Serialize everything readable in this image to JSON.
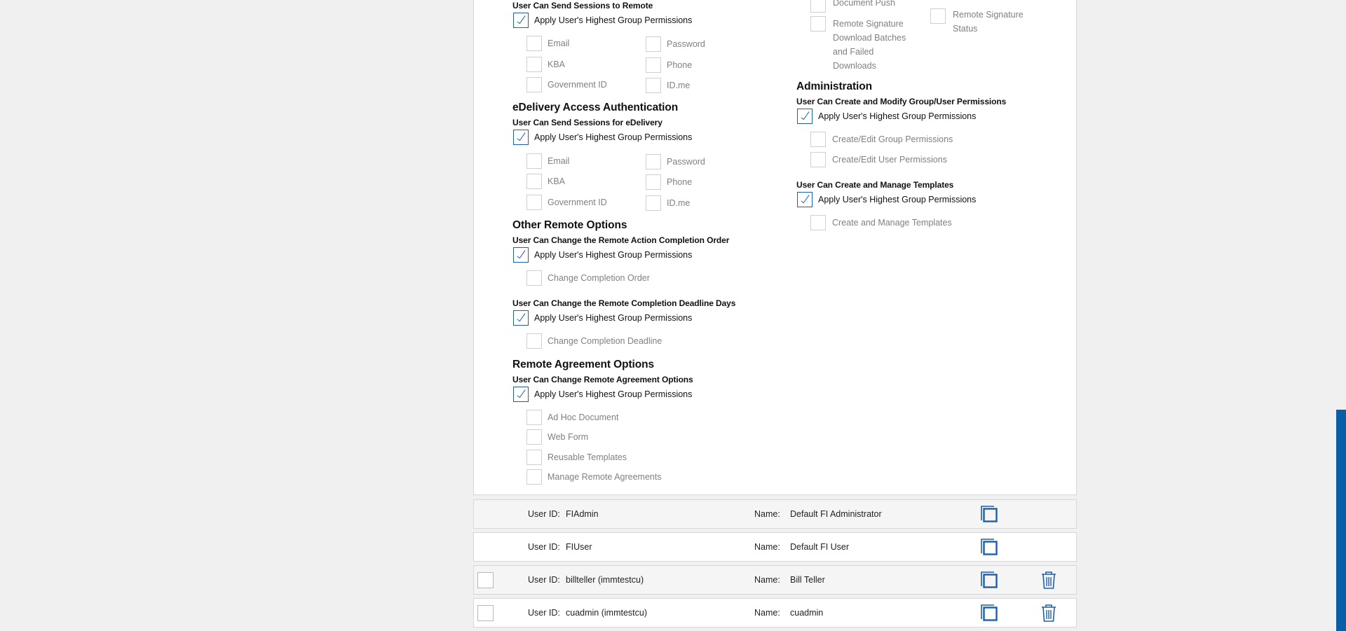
{
  "remote_send": {
    "sub": "User Can Send Sessions to Remote",
    "apply": "Apply User's Highest Group Permissions",
    "options": [
      "Email",
      "Password",
      "KBA",
      "Phone",
      "Government ID",
      "ID.me"
    ]
  },
  "edelivery": {
    "title": "eDelivery Access Authentication",
    "sub": "User Can Send Sessions for eDelivery",
    "apply": "Apply User's Highest Group Permissions",
    "options": [
      "Email",
      "Password",
      "KBA",
      "Phone",
      "Government ID",
      "ID.me"
    ]
  },
  "other_remote": {
    "title": "Other Remote Options",
    "sub1": "User Can Change the Remote Action Completion Order",
    "apply1": "Apply User's Highest Group Permissions",
    "opt1": "Change Completion Order",
    "sub2": "User Can Change the Remote Completion Deadline Days",
    "apply2": "Apply User's Highest Group Permissions",
    "opt2": "Change Completion Deadline"
  },
  "remote_agreement": {
    "title": "Remote Agreement Options",
    "sub": "User Can Change Remote Agreement Options",
    "apply": "Apply User's Highest Group Permissions",
    "options": [
      "Ad Hoc Document",
      "Web Form",
      "Reusable Templates",
      "Manage Remote Agreements"
    ]
  },
  "top_right": {
    "document_push": "Document Push",
    "remote_sig_download": "Remote Signature Download Batches and Failed Downloads",
    "remote_sig_status": "Remote Signature Status"
  },
  "administration": {
    "title": "Administration",
    "sub1": "User Can Create and Modify Group/User Permissions",
    "apply1": "Apply User's Highest Group Permissions",
    "opt1a": "Create/Edit Group Permissions",
    "opt1b": "Create/Edit User Permissions",
    "sub2": "User Can Create and Manage Templates",
    "apply2": "Apply User's Highest Group Permissions",
    "opt2": "Create and Manage Templates"
  },
  "users": {
    "user_id_label": "User ID:",
    "name_label": "Name:",
    "rows": [
      {
        "user_id": "FIAdmin",
        "name": "Default FI Administrator"
      },
      {
        "user_id": "FIUser",
        "name": "Default FI User"
      },
      {
        "user_id": "billteller (immtestcu)",
        "name": "Bill Teller"
      },
      {
        "user_id": "cuadmin (immtestcu)",
        "name": "cuadmin"
      }
    ]
  },
  "colors": {
    "accent": "#1f5fa8",
    "scrollbar": "#0a5ea8"
  }
}
